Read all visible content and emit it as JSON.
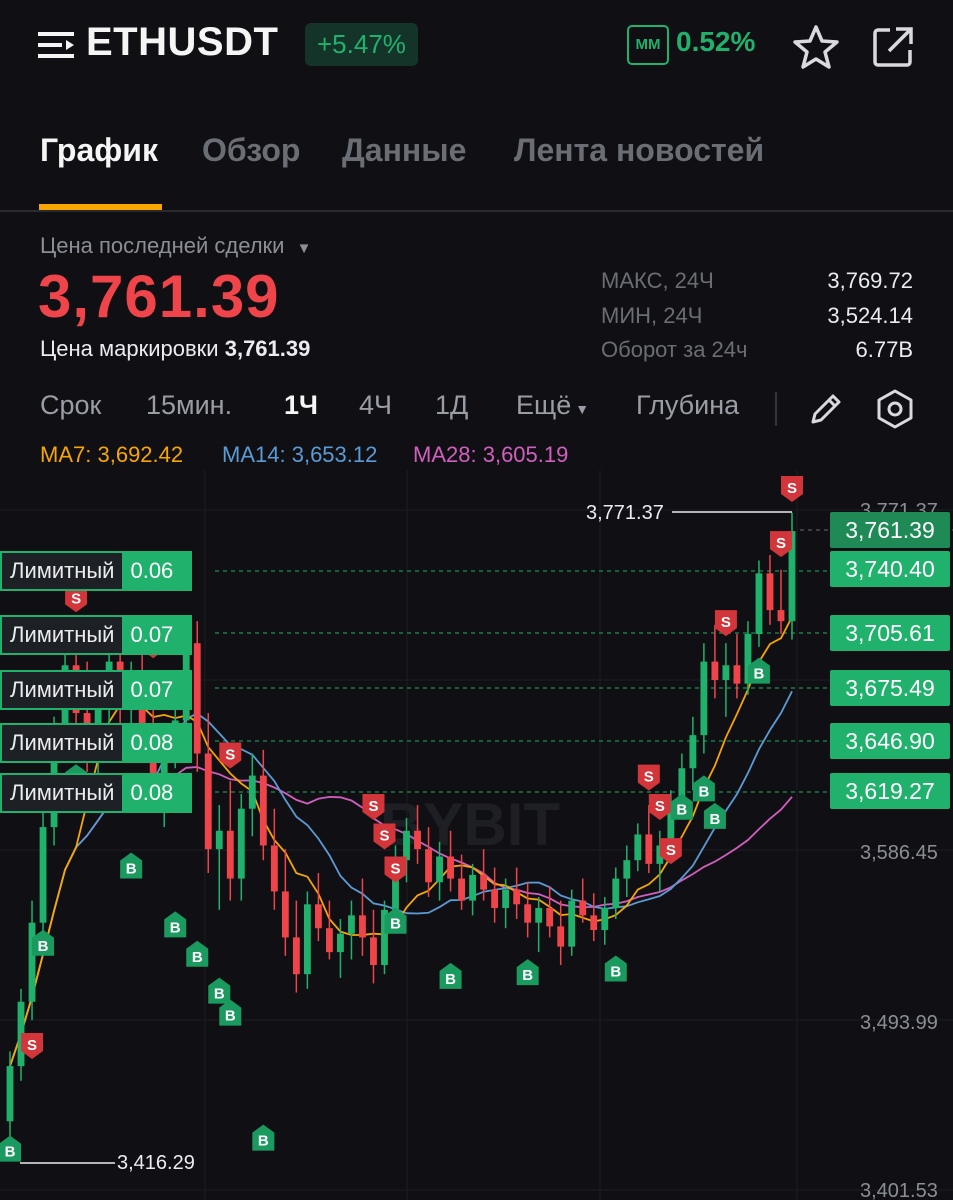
{
  "header": {
    "symbol": "ETHUSDT",
    "change": "+5.47%",
    "mm_badge": "MM",
    "mm_value": "0.52%",
    "icons": [
      "menu-icon",
      "star-icon",
      "share-icon"
    ]
  },
  "tabs": [
    {
      "label": "График",
      "active": true
    },
    {
      "label": "Обзор",
      "active": false
    },
    {
      "label": "Данные",
      "active": false
    },
    {
      "label": "Лента новостей",
      "active": false
    }
  ],
  "price": {
    "label": "Цена последней сделки",
    "last": "3,761.39",
    "mark_label": "Цена маркировки",
    "mark_value": "3,761.39"
  },
  "stats": [
    {
      "label": "МАКС, 24Ч",
      "value": "3,769.72"
    },
    {
      "label": "МИН, 24Ч",
      "value": "3,524.14"
    },
    {
      "label": "Оборот за 24ч",
      "value": "6.77B"
    }
  ],
  "timeframes": {
    "term": "Срок",
    "items": [
      "15мин.",
      "1Ч",
      "4Ч",
      "1Д"
    ],
    "active": "1Ч",
    "more": "Ещё",
    "depth": "Глубина"
  },
  "ma": {
    "ma7": {
      "label": "MA7:",
      "value": "3,692.42",
      "color": "#f7a600"
    },
    "ma14": {
      "label": "MA14:",
      "value": "3,653.12",
      "color": "#5b9bd5"
    },
    "ma28": {
      "label": "MA28:",
      "value": "3,605.19",
      "color": "#d25fc0"
    }
  },
  "colors": {
    "up": "#20b26c",
    "down": "#ef454a",
    "accent": "#f7a600",
    "background": "#101014"
  },
  "limit_orders": [
    {
      "type": "Лимитный",
      "qty": "0.06",
      "price": "3,740.40"
    },
    {
      "type": "Лимитный",
      "qty": "0.07",
      "price": "3,705.61"
    },
    {
      "type": "Лимитный",
      "qty": "0.07",
      "price": "3,675.49"
    },
    {
      "type": "Лимитный",
      "qty": "0.08",
      "price": "3,646.90"
    },
    {
      "type": "Лимитный",
      "qty": "0.08",
      "price": "3,619.27"
    }
  ],
  "chart_labels": {
    "current_price": "3,761.39",
    "high_marker": "3,771.37",
    "low_marker": "3,416.29",
    "axis_ticks": [
      "3,771.37",
      "3,586.45",
      "3,493.99",
      "3,401.53"
    ],
    "watermark": "BYBIT"
  },
  "chart_data": {
    "type": "candlestick",
    "ylim": [
      3401.53,
      3771.37
    ],
    "candles": [
      [
        3440,
        3478,
        3428,
        3470
      ],
      [
        3470,
        3512,
        3462,
        3505
      ],
      [
        3505,
        3560,
        3495,
        3548
      ],
      [
        3548,
        3612,
        3540,
        3600
      ],
      [
        3600,
        3660,
        3590,
        3650
      ],
      [
        3650,
        3700,
        3640,
        3688
      ],
      [
        3688,
        3712,
        3650,
        3662
      ],
      [
        3662,
        3690,
        3630,
        3640
      ],
      [
        3640,
        3680,
        3620,
        3670
      ],
      [
        3670,
        3702,
        3655,
        3690
      ],
      [
        3690,
        3705,
        3655,
        3665
      ],
      [
        3665,
        3690,
        3645,
        3684
      ],
      [
        3684,
        3700,
        3640,
        3648
      ],
      [
        3648,
        3668,
        3615,
        3622
      ],
      [
        3622,
        3655,
        3600,
        3648
      ],
      [
        3648,
        3670,
        3632,
        3658
      ],
      [
        3658,
        3710,
        3650,
        3700
      ],
      [
        3700,
        3712,
        3630,
        3640
      ],
      [
        3640,
        3662,
        3575,
        3588
      ],
      [
        3588,
        3612,
        3555,
        3598
      ],
      [
        3598,
        3625,
        3560,
        3572
      ],
      [
        3572,
        3618,
        3560,
        3610
      ],
      [
        3610,
        3640,
        3595,
        3628
      ],
      [
        3628,
        3642,
        3582,
        3590
      ],
      [
        3590,
        3610,
        3555,
        3565
      ],
      [
        3565,
        3588,
        3530,
        3540
      ],
      [
        3540,
        3560,
        3510,
        3520
      ],
      [
        3520,
        3565,
        3512,
        3558
      ],
      [
        3558,
        3575,
        3538,
        3545
      ],
      [
        3545,
        3560,
        3528,
        3532
      ],
      [
        3532,
        3550,
        3518,
        3542
      ],
      [
        3542,
        3560,
        3528,
        3552
      ],
      [
        3552,
        3572,
        3530,
        3540
      ],
      [
        3540,
        3555,
        3515,
        3525
      ],
      [
        3525,
        3560,
        3520,
        3555
      ],
      [
        3555,
        3590,
        3550,
        3582
      ],
      [
        3582,
        3605,
        3570,
        3598
      ],
      [
        3598,
        3612,
        3580,
        3588
      ],
      [
        3588,
        3600,
        3562,
        3570
      ],
      [
        3570,
        3592,
        3560,
        3584
      ],
      [
        3584,
        3598,
        3565,
        3572
      ],
      [
        3572,
        3585,
        3555,
        3560
      ],
      [
        3560,
        3580,
        3552,
        3574
      ],
      [
        3574,
        3588,
        3560,
        3566
      ],
      [
        3566,
        3578,
        3548,
        3556
      ],
      [
        3556,
        3572,
        3545,
        3566
      ],
      [
        3566,
        3578,
        3550,
        3558
      ],
      [
        3558,
        3570,
        3540,
        3548
      ],
      [
        3548,
        3562,
        3532,
        3556
      ],
      [
        3556,
        3568,
        3540,
        3546
      ],
      [
        3546,
        3560,
        3525,
        3535
      ],
      [
        3535,
        3566,
        3530,
        3560
      ],
      [
        3560,
        3572,
        3548,
        3552
      ],
      [
        3552,
        3564,
        3538,
        3544
      ],
      [
        3544,
        3562,
        3536,
        3556
      ],
      [
        3556,
        3578,
        3550,
        3572
      ],
      [
        3572,
        3590,
        3562,
        3582
      ],
      [
        3582,
        3602,
        3576,
        3596
      ],
      [
        3596,
        3612,
        3575,
        3580
      ],
      [
        3580,
        3598,
        3565,
        3590
      ],
      [
        3590,
        3620,
        3585,
        3612
      ],
      [
        3612,
        3640,
        3605,
        3632
      ],
      [
        3632,
        3660,
        3620,
        3650
      ],
      [
        3650,
        3700,
        3640,
        3690
      ],
      [
        3690,
        3710,
        3670,
        3680
      ],
      [
        3680,
        3700,
        3660,
        3688
      ],
      [
        3688,
        3705,
        3670,
        3678
      ],
      [
        3678,
        3712,
        3672,
        3705
      ],
      [
        3705,
        3745,
        3698,
        3738
      ],
      [
        3738,
        3748,
        3710,
        3718
      ],
      [
        3718,
        3740,
        3705,
        3712
      ],
      [
        3712,
        3771,
        3702,
        3761
      ]
    ]
  }
}
